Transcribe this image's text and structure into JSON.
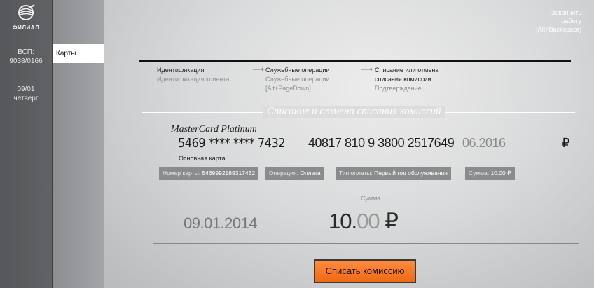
{
  "sidebar": {
    "branch": "ФИЛИАЛ",
    "vsp_label": "ВСП:",
    "vsp_value": "9038/0166",
    "date": "09/01",
    "weekday": "четверг"
  },
  "nav": {
    "items": [
      {
        "label": "Карты",
        "active": true
      }
    ]
  },
  "header": {
    "finish_line1": "Закончить",
    "finish_line2": "работу",
    "finish_line3": "[Alt+Backspace]"
  },
  "steps": [
    {
      "title": "Идентификация",
      "sub1": "Идентификация клиента",
      "sub2": ""
    },
    {
      "title": "Служебные операции",
      "sub1": "Служебные операции",
      "sub2": "[Alt+PageDown]"
    },
    {
      "title": "Списание или отмена",
      "title2": "списания комиссии",
      "sub1": "Подтверждение"
    }
  ],
  "section_title": "Списание и отмена списания комиссий",
  "card": {
    "type": "MasterCard Platinum",
    "pan": "5469 **** **** 7432",
    "account": "40817 810 9 3800 2517649",
    "expiry": "06.2016",
    "currency_symbol": "₽",
    "kind": "Основная карта"
  },
  "chips": [
    {
      "label": "Номер карты:",
      "value": "5469992189317432"
    },
    {
      "label": "Операция:",
      "value": "Оплата"
    },
    {
      "label": "Тип оплаты:",
      "value": "Первый год обслуживания"
    },
    {
      "label": "Сумма:",
      "value": "10.00 ₽"
    }
  ],
  "summary": {
    "sum_label": "Сумма",
    "date": "09.01.2014",
    "amount_int": "10.",
    "amount_frac": "00",
    "amount_currency": " ₽"
  },
  "action": {
    "button_label": "Списать комиссию"
  },
  "colors": {
    "accent": "#f57a25",
    "sidebar": "#5f6063"
  }
}
